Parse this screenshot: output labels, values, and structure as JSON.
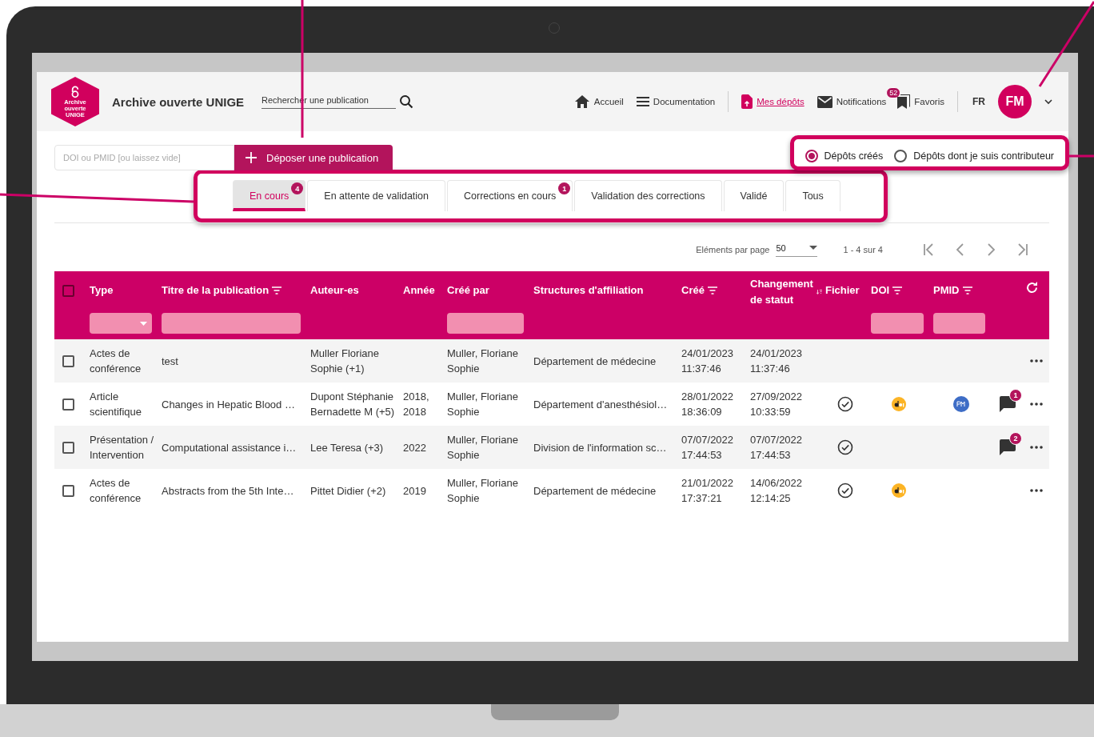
{
  "header": {
    "logo_text": "Archive ouverte UNIGE",
    "site_title": "Archive ouverte UNIGE",
    "search": {
      "placeholder": "Rechercher une publication"
    },
    "nav": [
      {
        "kind": "home",
        "label": "Accueil",
        "selected": false
      },
      {
        "kind": "menu",
        "label": "Documentation",
        "selected": false
      },
      {
        "kind": "upload",
        "label": "Mes dépôts",
        "selected": true
      },
      {
        "kind": "mail",
        "label": "Notifications",
        "selected": false,
        "badge": "52"
      },
      {
        "kind": "bookmark",
        "label": "Favoris",
        "selected": false
      }
    ],
    "language": {
      "label": "FR",
      "selected": true
    },
    "avatar": "FM"
  },
  "deposit": {
    "placeholder": "DOI ou PMID [ou laissez vide]",
    "button": "Déposer une publication"
  },
  "filters": [
    {
      "label": "Dépôts créés",
      "selected": true
    },
    {
      "label": "Dépôts dont je suis contributeur",
      "selected": false
    }
  ],
  "tabs": [
    {
      "label": "En cours",
      "selected": true,
      "badge": "4"
    },
    {
      "label": "En attente de validation",
      "selected": false
    },
    {
      "label": "Corrections en cours",
      "selected": false,
      "badge": "1"
    },
    {
      "label": "Validation des corrections",
      "selected": false
    },
    {
      "label": "Validé",
      "selected": false
    },
    {
      "label": "Tous",
      "selected": false
    }
  ],
  "pagination": {
    "label": "Eléments par page",
    "page_size": "50",
    "range": "1 - 4 sur 4"
  },
  "table": {
    "all_selected": false,
    "columns": [
      {
        "label": "Type",
        "filter_dropdown": true
      },
      {
        "label": "Titre de la publication",
        "sortable": true,
        "filter_field": true
      },
      {
        "label": "Auteur-es"
      },
      {
        "label": "Année"
      },
      {
        "label": "Créé par",
        "filter_field": true
      },
      {
        "label": "Structures d'affiliation"
      },
      {
        "label": "Créé",
        "sortable": true
      },
      {
        "label": "Changement de statut",
        "sorted_descending": true
      },
      {
        "label": "Fichier"
      },
      {
        "label": "DOI",
        "sortable": true,
        "filter_field": true
      },
      {
        "label": "PMID",
        "sortable": true,
        "filter_field": true
      }
    ],
    "rows": [
      {
        "selected": false,
        "type": "Actes de conférence",
        "title": "test",
        "authors": "Muller Floriane Sophie (+1)",
        "created_by": "Muller, Floriane Sophie",
        "structure": "Département de médecine",
        "created": "24/01/2023 11:37:46",
        "status_changed": "24/01/2023 11:37:46",
        "file": false,
        "doi": false,
        "pmid": false
      },
      {
        "selected": false,
        "type": "Article scientifique",
        "title": "Changes in Hepatic Blood …",
        "authors": "Dupont Stéphanie Bernadette M (+5)",
        "year": "2018, 2018",
        "created_by": "Muller, Floriane Sophie",
        "structure": "Département d'anesthésiol…",
        "created": "28/01/2022 18:36:09",
        "status_changed": "27/09/2022 10:33:59",
        "file": true,
        "doi": true,
        "pmid": true,
        "comments": "1"
      },
      {
        "selected": false,
        "type": "Présentation / Intervention",
        "title": "Computational assistance i…",
        "authors": "Lee Teresa (+3)",
        "year": "2022",
        "created_by": "Muller, Floriane Sophie",
        "structure": "Division de l'information sc…",
        "created": "07/07/2022 17:44:53",
        "status_changed": "07/07/2022 17:44:53",
        "file": true,
        "doi": false,
        "pmid": false,
        "comments": "2"
      },
      {
        "selected": false,
        "type": "Actes de conférence",
        "title": "Abstracts from the 5th Inte…",
        "authors": "Pittet Didier (+2)",
        "year": "2019",
        "created_by": "Muller, Floriane Sophie",
        "structure": "Département de médecine",
        "created": "21/01/2022 17:37:21",
        "status_changed": "14/06/2022 12:14:25",
        "file": true,
        "doi": true,
        "pmid": false
      }
    ]
  }
}
